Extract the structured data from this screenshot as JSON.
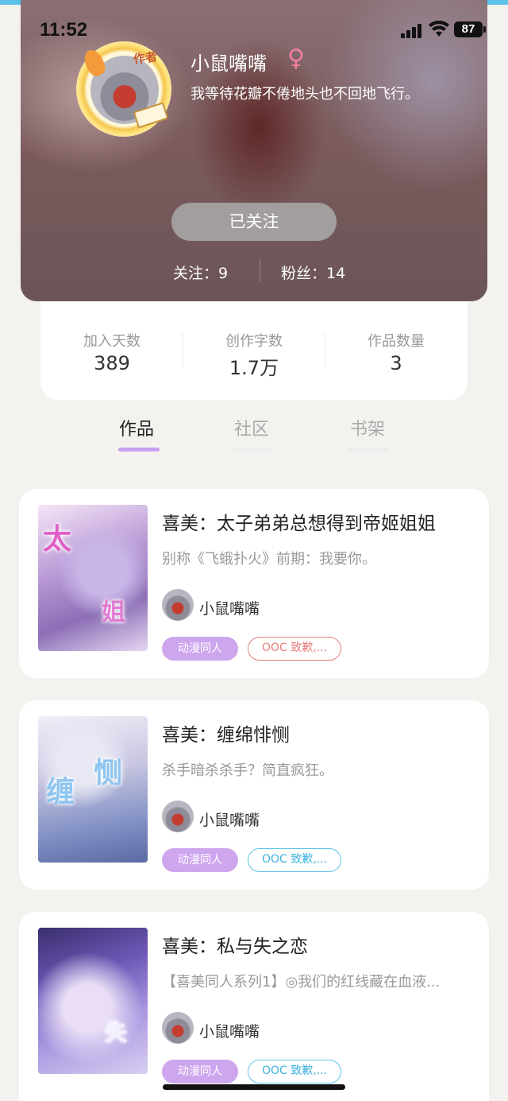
{
  "status_bar": {
    "time": "11:52",
    "battery": "87"
  },
  "profile": {
    "name": "小鼠嘴嘴",
    "gender_symbol": "♀",
    "bio": "我等待花瓣不倦地头也不回地飞行。",
    "author_badge": "作者",
    "follow_button": "已关注",
    "following": "关注：9",
    "followers": "粉丝：14"
  },
  "stats": [
    {
      "label": "加入天数",
      "value": "389"
    },
    {
      "label": "创作字数",
      "value": "1.7万"
    },
    {
      "label": "作品数量",
      "value": "3"
    }
  ],
  "tabs": [
    {
      "label": "作品",
      "active": true
    },
    {
      "label": "社区",
      "active": false
    },
    {
      "label": "书架",
      "active": false
    }
  ],
  "colors": {
    "accent": "#c8a0ee",
    "tag_fill": "#cda6ee",
    "tag_outline_red": "#e77b7b",
    "tag_outline_blue": "#5ec3e8"
  },
  "books": [
    {
      "title": "喜美：太子弟弟总想得到帝姬姐姐",
      "description": "别称《飞蛾扑火》前期：我要你。",
      "author": "小鼠嘴嘴",
      "tags": [
        "动漫同人",
        "OOC 致歉,..."
      ]
    },
    {
      "title": "喜美：缠绵悱恻",
      "description": "杀手暗杀杀手？简直疯狂。",
      "author": "小鼠嘴嘴",
      "tags": [
        "动漫同人",
        "OOC 致歉,..."
      ]
    },
    {
      "title": "喜美：私与失之恋",
      "description": "【喜美同人系列1】◎我们的红线藏在血液...",
      "author": "小鼠嘴嘴",
      "tags": [
        "动漫同人",
        "OOC 致歉,..."
      ]
    }
  ]
}
